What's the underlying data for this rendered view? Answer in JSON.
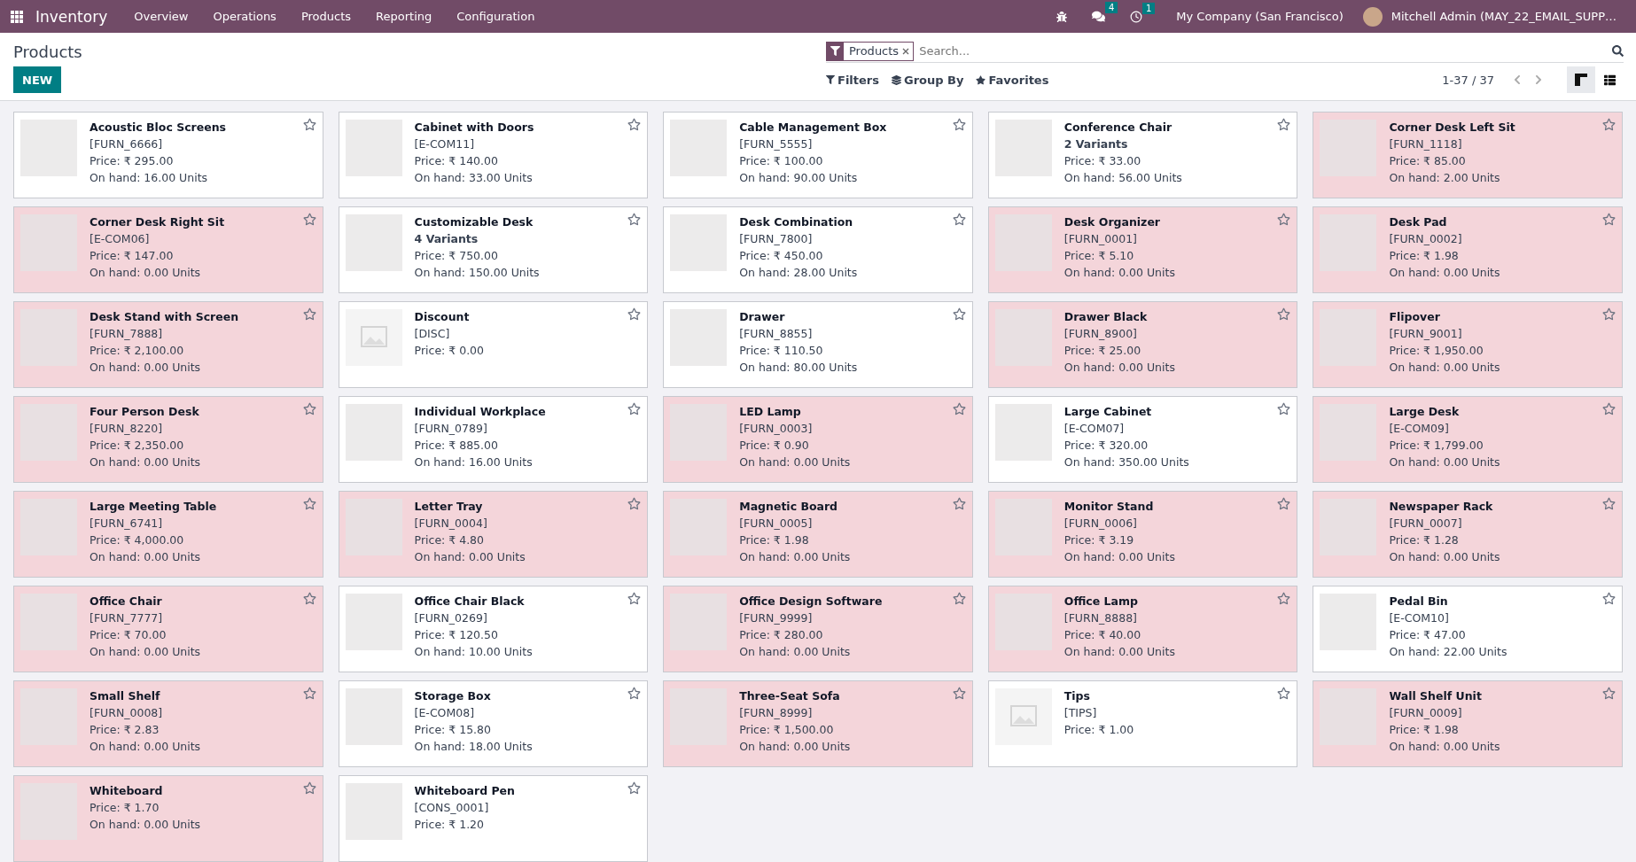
{
  "navbar": {
    "app": "Inventory",
    "menu": [
      "Overview",
      "Operations",
      "Products",
      "Reporting",
      "Configuration"
    ],
    "messages_badge": "4",
    "activities_badge": "1",
    "company": "My Company (San Francisco)",
    "user": "Mitchell Admin (MAY_22_EMAIL_SUPP…"
  },
  "control_panel": {
    "title": "Products",
    "new_button": "NEW",
    "facet": "Products",
    "search_placeholder": "Search...",
    "filters": "Filters",
    "group_by": "Group By",
    "favorites": "Favorites",
    "pager": "1-37 / 37",
    "views": [
      {
        "kind": "kanban",
        "selected": true
      },
      {
        "kind": "list",
        "selected": false
      }
    ]
  },
  "products": [
    {
      "name": "Acoustic Bloc Screens",
      "reference": "[FURN_6666]",
      "price": "Price: ₹ 295.00",
      "on_hand": "On hand: 16.00 Units",
      "kind": "photo",
      "alert": false
    },
    {
      "name": "Cabinet with Doors",
      "reference": "[E-COM11]",
      "price": "Price: ₹ 140.00",
      "on_hand": "On hand: 33.00 Units",
      "kind": "photo",
      "alert": false
    },
    {
      "name": "Cable Management Box",
      "reference": "[FURN_5555]",
      "price": "Price: ₹ 100.00",
      "on_hand": "On hand: 90.00 Units",
      "kind": "photo",
      "alert": false
    },
    {
      "name": "Conference Chair",
      "variants": "2 Variants",
      "price": "Price: ₹ 33.00",
      "on_hand": "On hand: 56.00 Units",
      "kind": "photo",
      "alert": false
    },
    {
      "name": "Corner Desk Left Sit",
      "reference": "[FURN_1118]",
      "price": "Price: ₹ 85.00",
      "on_hand": "On hand: 2.00 Units",
      "kind": "photo",
      "alert": true
    },
    {
      "name": "Corner Desk Right Sit",
      "reference": "[E-COM06]",
      "price": "Price: ₹ 147.00",
      "on_hand": "On hand: 0.00 Units",
      "kind": "photo",
      "alert": true
    },
    {
      "name": "Customizable Desk",
      "variants": "4 Variants",
      "price": "Price: ₹ 750.00",
      "on_hand": "On hand: 150.00 Units",
      "kind": "photo",
      "alert": false
    },
    {
      "name": "Desk Combination",
      "reference": "[FURN_7800]",
      "price": "Price: ₹ 450.00",
      "on_hand": "On hand: 28.00 Units",
      "kind": "photo",
      "alert": false
    },
    {
      "name": "Desk Organizer",
      "reference": "[FURN_0001]",
      "price": "Price: ₹ 5.10",
      "on_hand": "On hand: 0.00 Units",
      "kind": "photo",
      "alert": true
    },
    {
      "name": "Desk Pad",
      "reference": "[FURN_0002]",
      "price": "Price: ₹ 1.98",
      "on_hand": "On hand: 0.00 Units",
      "kind": "photo",
      "alert": true
    },
    {
      "name": "Desk Stand with Screen",
      "reference": "[FURN_7888]",
      "price": "Price: ₹ 2,100.00",
      "on_hand": "On hand: 0.00 Units",
      "kind": "photo",
      "alert": true
    },
    {
      "name": "Discount",
      "reference": "[DISC]",
      "price": "Price: ₹ 0.00",
      "kind": "placeholder",
      "alert": false
    },
    {
      "name": "Drawer",
      "reference": "[FURN_8855]",
      "price": "Price: ₹ 110.50",
      "on_hand": "On hand: 80.00 Units",
      "kind": "photo",
      "alert": false
    },
    {
      "name": "Drawer Black",
      "reference": "[FURN_8900]",
      "price": "Price: ₹ 25.00",
      "on_hand": "On hand: 0.00 Units",
      "kind": "photo",
      "alert": true
    },
    {
      "name": "Flipover",
      "reference": "[FURN_9001]",
      "price": "Price: ₹ 1,950.00",
      "on_hand": "On hand: 0.00 Units",
      "kind": "photo",
      "alert": true
    },
    {
      "name": "Four Person Desk",
      "reference": "[FURN_8220]",
      "price": "Price: ₹ 2,350.00",
      "on_hand": "On hand: 0.00 Units",
      "kind": "photo",
      "alert": true
    },
    {
      "name": "Individual Workplace",
      "reference": "[FURN_0789]",
      "price": "Price: ₹ 885.00",
      "on_hand": "On hand: 16.00 Units",
      "kind": "photo",
      "alert": false
    },
    {
      "name": "LED Lamp",
      "reference": "[FURN_0003]",
      "price": "Price: ₹ 0.90",
      "on_hand": "On hand: 0.00 Units",
      "kind": "photo",
      "alert": true
    },
    {
      "name": "Large Cabinet",
      "reference": "[E-COM07]",
      "price": "Price: ₹ 320.00",
      "on_hand": "On hand: 350.00 Units",
      "kind": "photo",
      "alert": false
    },
    {
      "name": "Large Desk",
      "reference": "[E-COM09]",
      "price": "Price: ₹ 1,799.00",
      "on_hand": "On hand: 0.00 Units",
      "kind": "photo",
      "alert": true
    },
    {
      "name": "Large Meeting Table",
      "reference": "[FURN_6741]",
      "price": "Price: ₹ 4,000.00",
      "on_hand": "On hand: 0.00 Units",
      "kind": "photo",
      "alert": true
    },
    {
      "name": "Letter Tray",
      "reference": "[FURN_0004]",
      "price": "Price: ₹ 4.80",
      "on_hand": "On hand: 0.00 Units",
      "kind": "photo",
      "alert": true
    },
    {
      "name": "Magnetic Board",
      "reference": "[FURN_0005]",
      "price": "Price: ₹ 1.98",
      "on_hand": "On hand: 0.00 Units",
      "kind": "photo",
      "alert": true
    },
    {
      "name": "Monitor Stand",
      "reference": "[FURN_0006]",
      "price": "Price: ₹ 3.19",
      "on_hand": "On hand: 0.00 Units",
      "kind": "photo",
      "alert": true
    },
    {
      "name": "Newspaper Rack",
      "reference": "[FURN_0007]",
      "price": "Price: ₹ 1.28",
      "on_hand": "On hand: 0.00 Units",
      "kind": "photo",
      "alert": true
    },
    {
      "name": "Office Chair",
      "reference": "[FURN_7777]",
      "price": "Price: ₹ 70.00",
      "on_hand": "On hand: 0.00 Units",
      "kind": "photo",
      "alert": true
    },
    {
      "name": "Office Chair Black",
      "reference": "[FURN_0269]",
      "price": "Price: ₹ 120.50",
      "on_hand": "On hand: 10.00 Units",
      "kind": "photo",
      "alert": false
    },
    {
      "name": "Office Design Software",
      "reference": "[FURN_9999]",
      "price": "Price: ₹ 280.00",
      "on_hand": "On hand: 0.00 Units",
      "kind": "photo",
      "alert": true
    },
    {
      "name": "Office Lamp",
      "reference": "[FURN_8888]",
      "price": "Price: ₹ 40.00",
      "on_hand": "On hand: 0.00 Units",
      "kind": "photo",
      "alert": true
    },
    {
      "name": "Pedal Bin",
      "reference": "[E-COM10]",
      "price": "Price: ₹ 47.00",
      "on_hand": "On hand: 22.00 Units",
      "kind": "photo",
      "alert": false
    },
    {
      "name": "Small Shelf",
      "reference": "[FURN_0008]",
      "price": "Price: ₹ 2.83",
      "on_hand": "On hand: 0.00 Units",
      "kind": "photo",
      "alert": true
    },
    {
      "name": "Storage Box",
      "reference": "[E-COM08]",
      "price": "Price: ₹ 15.80",
      "on_hand": "On hand: 18.00 Units",
      "kind": "photo",
      "alert": false
    },
    {
      "name": "Three-Seat Sofa",
      "reference": "[FURN_8999]",
      "price": "Price: ₹ 1,500.00",
      "on_hand": "On hand: 0.00 Units",
      "kind": "photo",
      "alert": true
    },
    {
      "name": "Tips",
      "reference": "[TIPS]",
      "price": "Price: ₹ 1.00",
      "kind": "placeholder",
      "alert": false
    },
    {
      "name": "Wall Shelf Unit",
      "reference": "[FURN_0009]",
      "price": "Price: ₹ 1.98",
      "on_hand": "On hand: 0.00 Units",
      "kind": "photo",
      "alert": true
    },
    {
      "name": "Whiteboard",
      "price": "Price: ₹ 1.70",
      "on_hand": "On hand: 0.00 Units",
      "kind": "photo",
      "alert": true
    },
    {
      "name": "Whiteboard Pen",
      "reference": "[CONS_0001]",
      "price": "Price: ₹ 1.20",
      "kind": "photo",
      "alert": false
    }
  ]
}
